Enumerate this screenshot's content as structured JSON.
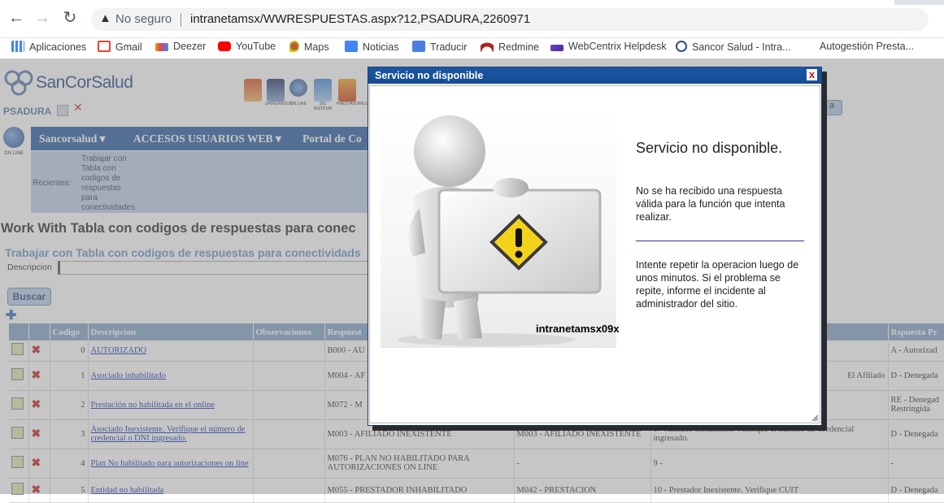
{
  "browser": {
    "security_label": "No seguro",
    "url": "intranetamsx/WWRESPUESTAS.aspx?12,PSADURA,2260971",
    "bookmarks": [
      "Aplicaciones",
      "Gmail",
      "Deezer",
      "YouTube",
      "Maps",
      "Noticias",
      "Traducir",
      "Redmine",
      "WebCentrix Helpdesk",
      "Sancor Salud - Intra...",
      "Autogestión Presta..."
    ]
  },
  "header": {
    "logo_text": "SanCorSalud",
    "username": "PSADURA",
    "online_label": "ON LINE",
    "tool_labels": [
      "",
      "SRINGREDOS",
      "ON LINE",
      "SIG INSTRUM",
      "PRESTADORES"
    ],
    "right_button": "a"
  },
  "menu": {
    "items": [
      "Sancorsalud",
      "ACCESOS USUARIOS WEB",
      "Portal de Co"
    ]
  },
  "recent": {
    "label": "Recientes:",
    "link": "Trabajar con Tabla con codigos de respuestas para conectividades"
  },
  "main": {
    "title": "Work With Tabla con codigos de respuestas para conec",
    "subtitle": "Trabajar con Tabla con codigos de respuestas para conectividads",
    "filter_label": "Descripcion",
    "search_button": "Buscar"
  },
  "grid": {
    "columns": [
      "",
      "",
      "Codigo",
      "Descripcion",
      "Observaciones",
      "Respuest",
      "",
      "",
      "Rspuesta Pr"
    ],
    "rows": [
      {
        "codigo": "0",
        "descripcion": "AUTORIZADO",
        "observaciones": "",
        "respuesta": "B000 - AU",
        "col6": "",
        "col7": "",
        "col8": "A - Autorizad"
      },
      {
        "codigo": "1",
        "descripcion": "Asociado inhabilitado",
        "observaciones": "",
        "respuesta": "M004 - AF",
        "col6": "",
        "col7": "El Afiliado",
        "col8": "D - Denegada"
      },
      {
        "codigo": "2",
        "descripcion": "Prestación no habilitada en el online",
        "observaciones": "",
        "respuesta": "M072 - M",
        "col6": "",
        "col7": "",
        "col8": "RE - Denegad Restringida"
      },
      {
        "codigo": "3",
        "descripcion": "Asociado Inexistente. Verifique el número de credencial o DNI ingresado.",
        "observaciones": "",
        "respuesta": "M003 - AFILIADO INEXISTENTE",
        "col6": "M003 - AFILIADO INEXISTENTE",
        "col7": "1 - Afiliado Inexistente. Verifique el número de Credencial ingresado.",
        "col8": "D - Denegada"
      },
      {
        "codigo": "4",
        "descripcion": "Plan No habilitado para autorizaciones on line",
        "observaciones": "",
        "respuesta": "M076 - PLAN NO HABILITADO PARA AUTORIZACIONES ON LINE",
        "col6": "-",
        "col7": "9 -",
        "col8": "-"
      },
      {
        "codigo": "5",
        "descripcion": "Entidad no habilitada",
        "observaciones": "",
        "respuesta": "M055 - PRESTADOR INHABILITADO",
        "col6": "M042 - PRESTACION",
        "col7": "10 - Prestador Inexistente. Verifique CUIT",
        "col8": "D - Denegada"
      }
    ]
  },
  "modal": {
    "title": "Servicio no disponible",
    "close": "x",
    "heading": "Servicio no disponible.",
    "message1": "No se ha recibido una respuesta válida para la función que intenta realizar.",
    "message2": "Intente repetir la operacion luego de unos minutos. Si el problema se repite, informe el incidente al administrador del sitio.",
    "hostname": "intranetamsx09x"
  }
}
